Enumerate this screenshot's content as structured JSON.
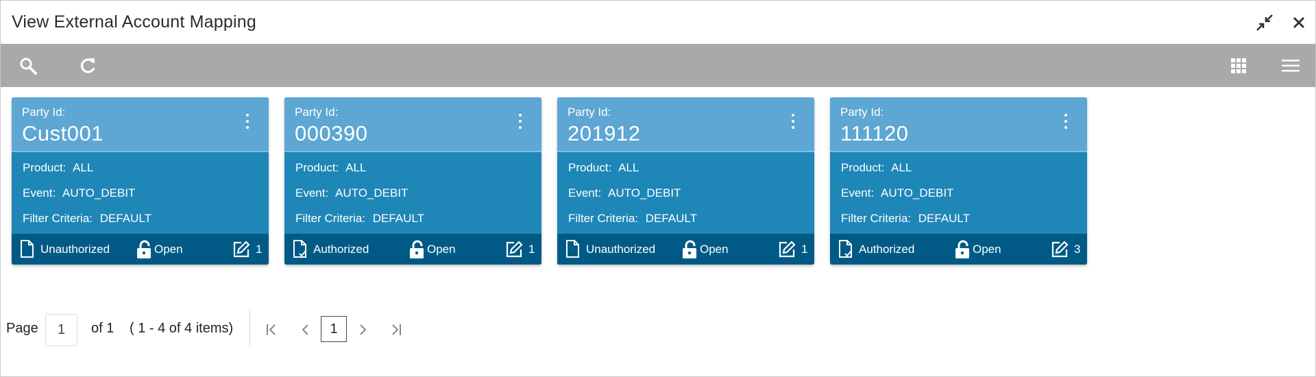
{
  "window": {
    "title": "View External Account Mapping"
  },
  "toolbar": {
    "search_icon": "search-icon",
    "refresh_icon": "refresh-icon",
    "grid_view_icon": "grid-view-icon",
    "list_view_icon": "list-view-icon"
  },
  "colors": {
    "toolbar_bg": "#a9a9a9",
    "card_head": "#5ea6d3",
    "card_body": "#1f86b8",
    "card_foot": "#005a85"
  },
  "cards": [
    {
      "party_label": "Party Id:",
      "party_id": "Cust001",
      "product_label": "Product:",
      "product": "ALL",
      "event_label": "Event:",
      "event": "AUTO_DEBIT",
      "filter_label": "Filter Criteria:",
      "filter": "DEFAULT",
      "auth_status": "Unauthorized",
      "auth_icon": "unauthorized-doc-icon",
      "record_status": "Open",
      "modification_count": "1"
    },
    {
      "party_label": "Party Id:",
      "party_id": "000390",
      "product_label": "Product:",
      "product": "ALL",
      "event_label": "Event:",
      "event": "AUTO_DEBIT",
      "filter_label": "Filter Criteria:",
      "filter": "DEFAULT",
      "auth_status": "Authorized",
      "auth_icon": "authorized-doc-icon",
      "record_status": "Open",
      "modification_count": "1"
    },
    {
      "party_label": "Party Id:",
      "party_id": "201912",
      "product_label": "Product:",
      "product": "ALL",
      "event_label": "Event:",
      "event": "AUTO_DEBIT",
      "filter_label": "Filter Criteria:",
      "filter": "DEFAULT",
      "auth_status": "Unauthorized",
      "auth_icon": "unauthorized-doc-icon",
      "record_status": "Open",
      "modification_count": "1"
    },
    {
      "party_label": "Party Id:",
      "party_id": "111120",
      "product_label": "Product:",
      "product": "ALL",
      "event_label": "Event:",
      "event": "AUTO_DEBIT",
      "filter_label": "Filter Criteria:",
      "filter": "DEFAULT",
      "auth_status": "Authorized",
      "auth_icon": "authorized-doc-icon",
      "record_status": "Open",
      "modification_count": "3"
    }
  ],
  "pagination": {
    "page_label": "Page",
    "page_value": "1",
    "of_label": "of 1",
    "items_summary": "( 1 - 4 of 4 items)",
    "current_page": "1"
  }
}
